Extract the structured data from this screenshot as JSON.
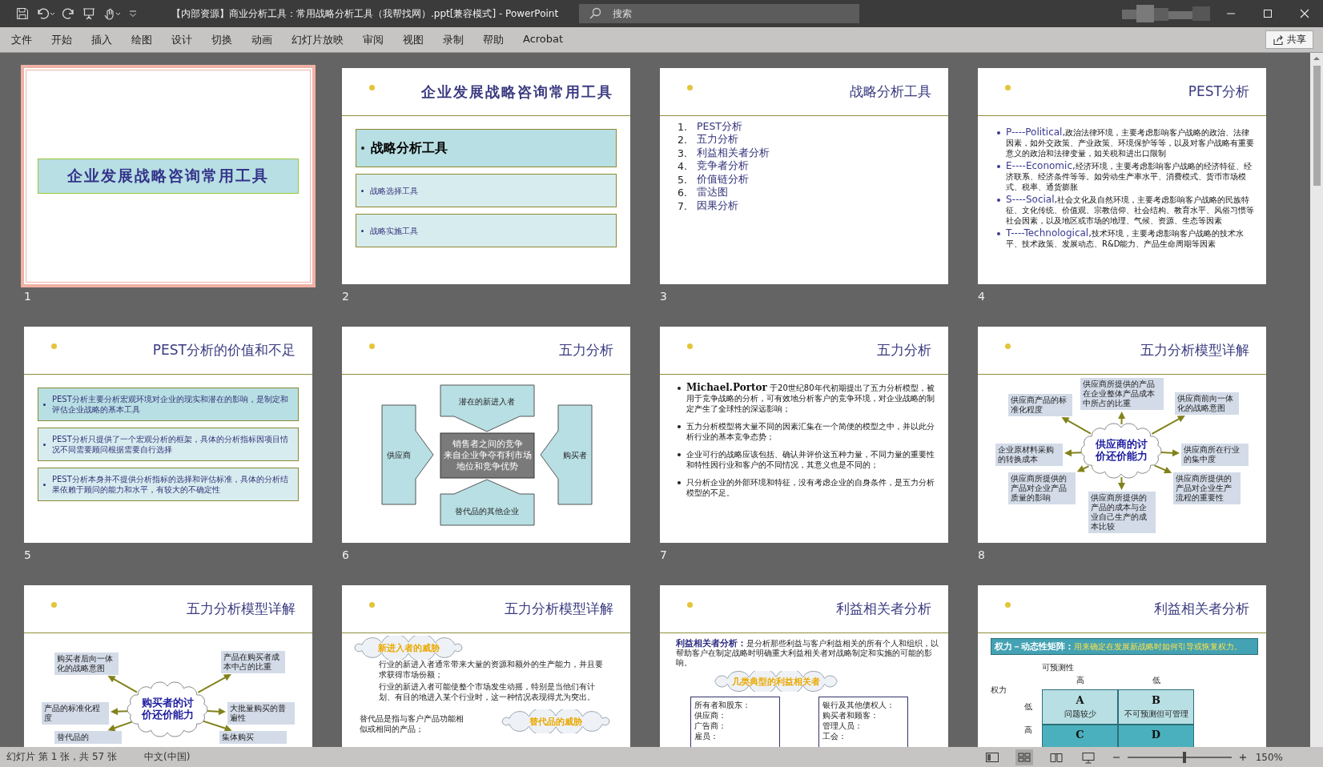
{
  "title_bar": {
    "title": "【内部资源】商业分析工具：常用战略分析工具（我帮找网）.ppt[兼容模式] - PowerPoint",
    "search": {
      "placeholder": "搜索"
    }
  },
  "menu": [
    "文件",
    "开始",
    "插入",
    "绘图",
    "设计",
    "切换",
    "动画",
    "幻灯片放映",
    "审阅",
    "视图",
    "录制",
    "帮助",
    "Acrobat"
  ],
  "share_button": "共享",
  "slides": [
    {
      "number": "1",
      "selected": true,
      "kind": "cover",
      "title": "企业发展战略咨询常用工具"
    },
    {
      "number": "2",
      "selected": false,
      "kind": "agenda",
      "title": "企业发展战略咨询常用工具",
      "boxes": [
        {
          "kind": "heading",
          "color": "#b8dfe3",
          "text": "战略分析工具"
        },
        {
          "kind": "item",
          "color": "#d7ecef",
          "text": "战略选择工具"
        },
        {
          "kind": "item",
          "color": "#d7ecef",
          "text": "战略实施工具"
        }
      ]
    },
    {
      "number": "3",
      "selected": false,
      "kind": "numbered",
      "title": "战略分析工具",
      "items": [
        {
          "marker": "1.",
          "text": "PEST分析"
        },
        {
          "marker": "2.",
          "text": "五力分析"
        },
        {
          "marker": "3.",
          "text": "利益相关者分析"
        },
        {
          "marker": "4.",
          "text": "竞争者分析"
        },
        {
          "marker": "5.",
          "text": "价值链分析"
        },
        {
          "marker": "6.",
          "text": "雷达图"
        },
        {
          "marker": "7.",
          "text": "因果分析"
        }
      ]
    },
    {
      "number": "4",
      "selected": false,
      "kind": "pest",
      "title": "PEST分析",
      "items": [
        {
          "lead": "P----Political,",
          "text": "政治法律环境，主要考虑影响客户战略的政治、法律因素，如外交政策、产业政策、环境保护等等，以及对客户战略有重要意义的政治和法律变量，如关税和进出口限制"
        },
        {
          "lead": "E----Economic,",
          "text": "经济环境，主要考虑影响客户战略的经济特征、经济联系、经济条件等等。如劳动生产率水平、消费模式、货币市场模式、税率、通货膨胀"
        },
        {
          "lead": "S----Social,",
          "text": "社会文化及自然环境，主要考虑影响客户战略的民族特征、文化传统、价值观、宗教信仰、社会结构、教育水平、风俗习惯等社会因素，以及地区或市场的地理、气候、资源、生态等因素"
        },
        {
          "lead": "T----Technological,",
          "text": "技术环境，主要考虑影响客户战略的技术水平、技术政策、发展动态、R&D能力、产品生命周期等因素"
        }
      ]
    },
    {
      "number": "5",
      "selected": false,
      "kind": "boxes",
      "title": "PEST分析的价值和不足",
      "boxes": [
        {
          "kind": "item",
          "color": "#b8dfe3",
          "text": "PEST分析主要分析宏观环境对企业的现实和潜在的影响，是制定和评估企业战略的基本工具"
        },
        {
          "kind": "item",
          "color": "#d7ecef",
          "text": "PEST分析只提供了一个宏观分析的框架，具体的分析指标因项目情况不同需要顾问根据需要自行选择"
        },
        {
          "kind": "item",
          "color": "#d7ecef",
          "text": "PEST分析本身并不提供分析指标的选择和评估标准，具体的分析结果依赖于顾问的能力和水平，有较大的不确定性"
        }
      ]
    },
    {
      "number": "6",
      "selected": false,
      "kind": "five_forces",
      "title": "五力分析",
      "top": "潜在的新进入者",
      "left": "供应商",
      "center": [
        "销售者之间的竞争",
        "来自企业争夺有利市场",
        "地位和竞争优势"
      ],
      "right": "购买者",
      "bottom": "替代品的其他企业"
    },
    {
      "number": "7",
      "selected": false,
      "kind": "bullets",
      "title": "五力分析",
      "items": [
        "**Michael.Portor** 于20世纪80年代初期提出了五力分析模型，被用于竞争战略的分析，可有效地分析客户的竞争环境，对企业战略的制定产生了全球性的深远影响；",
        "五力分析模型将大量不同的因素汇集在一个简便的模型之中，并以此分析行业的基本竞争态势；",
        "企业可行的战略应该包括、确认并评价这五种力量，不同力量的重要性和特性因行业和客户的不同情况，其意义也是不同的；",
        "只分析企业的外部环境和特征，没有考虑企业的自身条件，是五力分析模型的不足。"
      ]
    },
    {
      "number": "8",
      "selected": false,
      "kind": "mind_map",
      "title": "五力分析模型详解",
      "center": "供应商的讨价还价能力",
      "nodes": [
        "供应商产品的标准化程度",
        "供应商所提供的产品在企业整体产品成本中所占的比重",
        "供应商前向一体化的战略意图",
        "企业原材料采购的转换成本",
        "供应商所在行业的集中度",
        "供应商所提供的产品对企业产品质量的影响",
        "供应商所提供的产品的成本与企业自己生产的成本比较",
        "供应商所提供的产品对企业生产流程的重要性"
      ]
    },
    {
      "selected": false,
      "kind": "mind_map",
      "title": "五力分析模型详解",
      "center": "购买者的讨价还价能力",
      "nodes": [
        "购买者后向一体化的战略意图",
        "产品在购买者成本中占的比重",
        "产品的标准化程度",
        "大批量购买的普遍性",
        "替代品的",
        "集体购买"
      ]
    },
    {
      "selected": false,
      "kind": "threats",
      "title": "五力分析模型详解",
      "blocks": [
        {
          "kind": "cloud_left",
          "text": "新进入者的威胁"
        },
        {
          "kind": "paragraph",
          "text": "行业的新进入者通常带来大量的资源和额外的生产能力，并且要求获得市场份额；"
        },
        {
          "kind": "paragraph",
          "text": "行业的新进入者可能使整个市场发生动摇，特别是当他们有计划、有目的地进入某个行业时，这一种情况表现得尤为突出。"
        },
        {
          "kind": "side_note",
          "text": "替代品是指与客户产品功能相似或相同的产品；"
        },
        {
          "kind": "cloud_right",
          "text": "替代品的威胁"
        }
      ]
    },
    {
      "selected": false,
      "kind": "stakeholders",
      "title": "利益相关者分析",
      "lead": "利益相关者分析：",
      "text": "是分析那些利益与客户利益相关的所有个人和组织，以帮助客户在制定战略时明确重大利益相关者对战略制定和实施的可能的影响。",
      "cloud": "几类典型的利益相关者",
      "columns": [
        [
          "所有者和股东：",
          "供应商：",
          "广告商：",
          "雇员："
        ],
        [
          "银行及其他债权人：",
          "购买者和顾客：",
          "管理人员：",
          "工会："
        ]
      ]
    },
    {
      "selected": false,
      "kind": "matrix",
      "title": "利益相关者分析",
      "lead": "权力－动态性矩阵：",
      "text": "用来确定在发展新战略时如何引导或恢复权力。",
      "column_title": "可预测性",
      "column_labels": [
        "高",
        "低"
      ],
      "row_title": "权力",
      "row_labels": [
        "低",
        "高"
      ],
      "cells": [
        {
          "letter": "A",
          "text": "问题较少",
          "color": "#b8dfe3"
        },
        {
          "letter": "B",
          "text": "不可预测但可管理",
          "color": "#b8dfe3"
        },
        {
          "letter": "C",
          "color": "#4bb0bd"
        },
        {
          "letter": "D",
          "color": "#4bb0bd"
        }
      ]
    }
  ],
  "status_bar": {
    "slide_info": "幻灯片 第 1 张，共 57 张",
    "language": "中文(中国)",
    "view_buttons": [
      {
        "kind": "normal",
        "selected": false
      },
      {
        "kind": "sorter",
        "selected": true
      },
      {
        "kind": "reading",
        "selected": false
      },
      {
        "kind": "slideshow",
        "selected": false
      }
    ],
    "zoom_slider": {
      "level": 0.55
    },
    "zoom": "150%"
  }
}
